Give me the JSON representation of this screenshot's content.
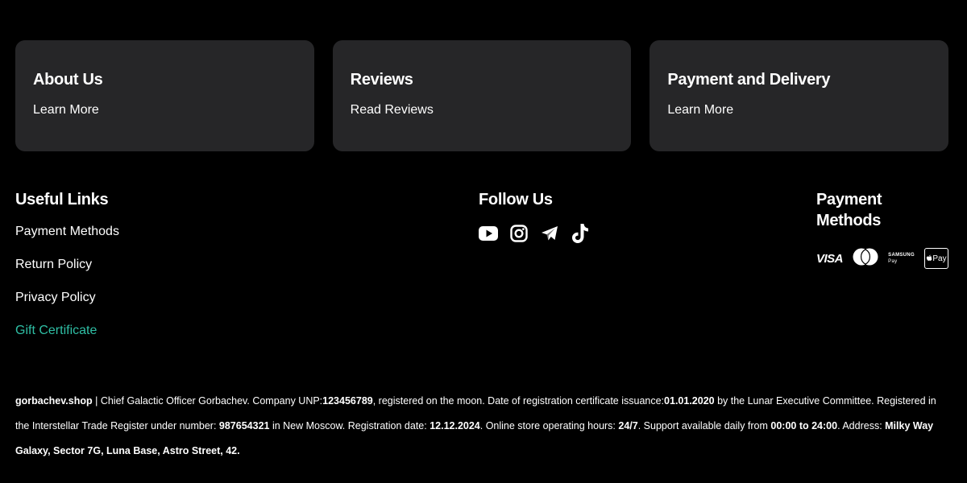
{
  "colors": {
    "accent": "#2fbfa5",
    "card_bg": "#262628",
    "page_bg": "#000000"
  },
  "cards": [
    {
      "title": "About Us",
      "link": "Learn More"
    },
    {
      "title": "Reviews",
      "link": "Read Reviews"
    },
    {
      "title": "Payment and Delivery",
      "link": "Learn More"
    }
  ],
  "useful_links": {
    "title": "Useful Links",
    "items": [
      "Payment Methods",
      "Return Policy",
      "Privacy Policy",
      "Gift Certificate"
    ]
  },
  "follow": {
    "title": "Follow Us",
    "icons": [
      "youtube-icon",
      "instagram-icon",
      "telegram-icon",
      "tiktok-icon"
    ]
  },
  "payment_methods": {
    "title": "Payment Methods",
    "visa": "VISA",
    "samsung_line1": "SAMSUNG",
    "samsung_line2": "Pay",
    "apple_pay": "Pay"
  },
  "legal": {
    "shop": "gorbachev.shop",
    "t1": " | Chief Galactic Officer Gorbachev. Company UNP:",
    "unp": "123456789",
    "t2": ", registered on the moon. Date of registration certificate issuance:",
    "cert_date": "01.01.2020",
    "t3": " by the Lunar Executive Committee. Registered in the Interstellar Trade Register under number: ",
    "reg_number": "987654321",
    "t4": " in New Moscow. Registration date: ",
    "reg_date": "12.12.2024",
    "t5": ". Online store operating hours: ",
    "hours": "24/7",
    "t6": ". Support available daily from ",
    "support": "00:00 to 24:00",
    "t7": ". Address: ",
    "address": "Milky Way Galaxy, Sector 7G, Luna Base, Astro Street, 42."
  }
}
